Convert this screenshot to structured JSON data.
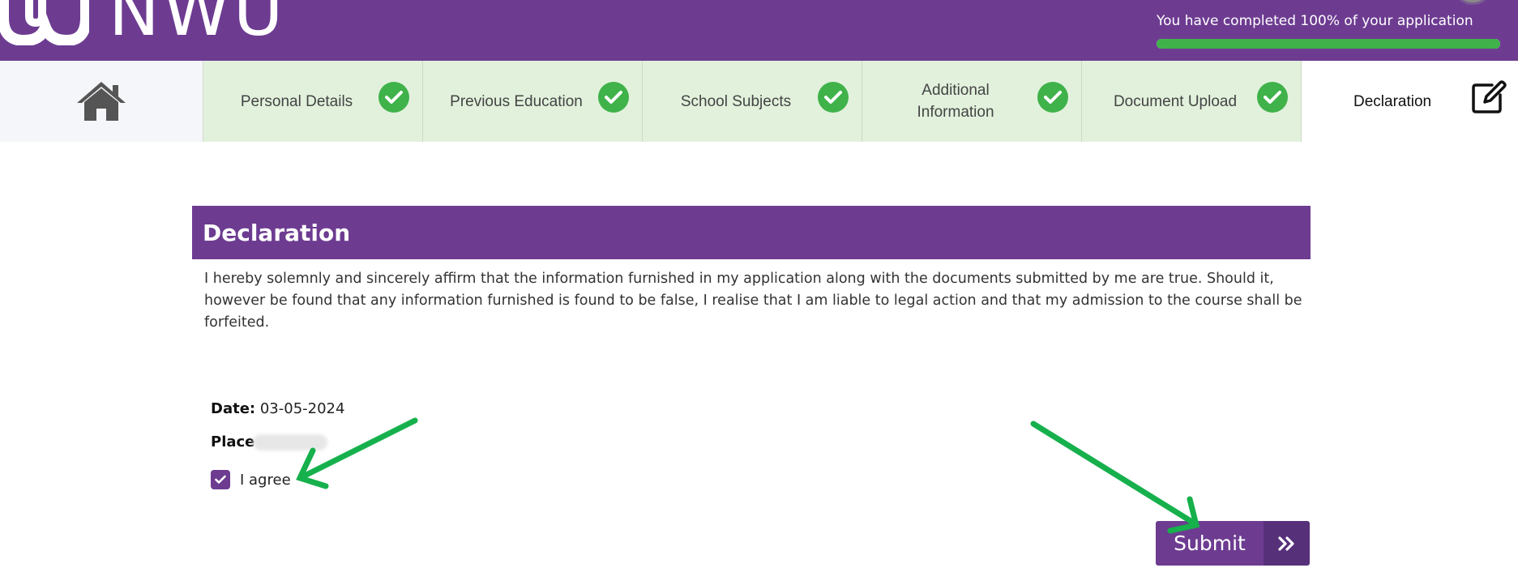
{
  "header": {
    "logo_text": "NWU",
    "progress_text": "You have completed 100% of your application",
    "progress_percent": 100
  },
  "steps": [
    {
      "label": "Personal Details",
      "status": "complete"
    },
    {
      "label": "Previous Education",
      "status": "complete"
    },
    {
      "label": "School Subjects",
      "status": "complete"
    },
    {
      "label": "Additional Information",
      "status": "complete"
    },
    {
      "label": "Document Upload",
      "status": "complete"
    },
    {
      "label": "Declaration",
      "status": "active"
    }
  ],
  "declaration": {
    "title": "Declaration",
    "text": "I hereby solemnly and sincerely affirm that the information furnished in my application along with the documents submitted by me are true. Should it, however be found that any information furnished is found to be false, I realise that I am liable to legal action and that my admission to the course shall be forfeited.",
    "date_label": "Date:",
    "date_value": "03-05-2024",
    "place_label": "Place",
    "agree_label": "I agree",
    "agree_checked": true,
    "submit_label": "Submit"
  },
  "colors": {
    "brand_purple": "#6d3c91",
    "step_complete_bg": "#e2f1dc",
    "check_green": "#3fb24a",
    "annotation_arrow": "#16b04c"
  },
  "icons": {
    "home": "home-icon",
    "check": "check-circle-icon",
    "edit": "edit-icon",
    "checkbox": "checkbox-checked-icon",
    "submit": "double-chevron-right-icon"
  }
}
